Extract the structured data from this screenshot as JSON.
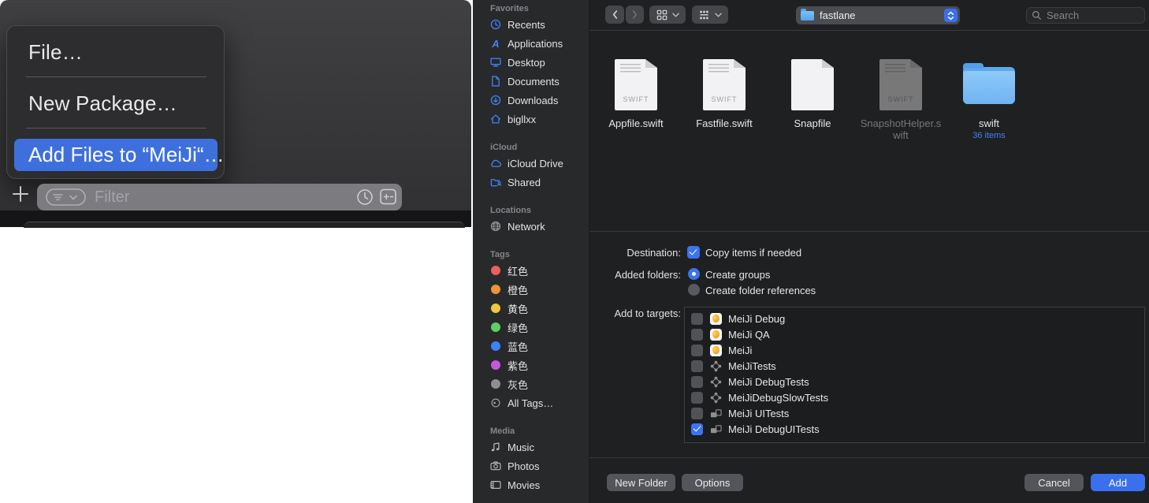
{
  "colors": {
    "accent_blue": "#3a74f2",
    "menu_highlight": "#3e70dd",
    "folder_blue": "#5ea8ef",
    "tag_red": "#ec5f5a",
    "tag_orange": "#eb9439",
    "tag_yellow": "#f0c63f",
    "tag_green": "#5dd064",
    "tag_blue": "#3d82f7",
    "tag_purple": "#c558dc",
    "tag_gray": "#8e8e93"
  },
  "context_menu": {
    "items": [
      {
        "label": "File…"
      },
      {
        "label": "New Package…"
      },
      {
        "label": "Add Files to “MeiJi“…",
        "highlighted": true
      }
    ]
  },
  "bottom_bar": {
    "filter_placeholder": "Filter"
  },
  "sidebar": {
    "sections": [
      {
        "title": "Favorites",
        "items": [
          {
            "label": "Recents"
          },
          {
            "label": "Applications"
          },
          {
            "label": "Desktop"
          },
          {
            "label": "Documents"
          },
          {
            "label": "Downloads"
          },
          {
            "label": "bigllxx"
          }
        ]
      },
      {
        "title": "iCloud",
        "items": [
          {
            "label": "iCloud Drive"
          },
          {
            "label": "Shared"
          }
        ]
      },
      {
        "title": "Locations",
        "items": [
          {
            "label": "Network"
          }
        ]
      },
      {
        "title": "Tags",
        "items": [
          {
            "label": "红色",
            "color": "#ec5f5a"
          },
          {
            "label": "橙色",
            "color": "#eb9439"
          },
          {
            "label": "黄色",
            "color": "#f0c63f"
          },
          {
            "label": "绿色",
            "color": "#5dd064"
          },
          {
            "label": "蓝色",
            "color": "#3d82f7"
          },
          {
            "label": "紫色",
            "color": "#c558dc"
          },
          {
            "label": "灰色",
            "color": "#8e8e93"
          },
          {
            "label": "All Tags…"
          }
        ]
      },
      {
        "title": "Media",
        "items": [
          {
            "label": "Music"
          },
          {
            "label": "Photos"
          },
          {
            "label": "Movies"
          }
        ]
      }
    ]
  },
  "toolbar": {
    "current_folder": "fastlane",
    "search_placeholder": "Search"
  },
  "files": [
    {
      "name": "Appfile.swift",
      "badge": "SWIFT"
    },
    {
      "name": "Fastfile.swift",
      "badge": "SWIFT"
    },
    {
      "name": "Snapfile",
      "badge": ""
    },
    {
      "name": "SnapshotHelper.swift",
      "badge": "SWIFT",
      "dimmed": true
    },
    {
      "name": "swift",
      "type": "folder",
      "item_count": "36 items"
    }
  ],
  "options": {
    "destination_label": "Destination:",
    "copy_items_label": "Copy items if needed",
    "copy_items_checked": true,
    "added_folders_label": "Added folders:",
    "create_groups_label": "Create groups",
    "create_groups_selected": true,
    "create_folder_refs_label": "Create folder references",
    "add_to_targets_label": "Add to targets:"
  },
  "targets": [
    {
      "name": "MeiJi Debug",
      "icon": "app",
      "checked": false
    },
    {
      "name": "MeiJi QA",
      "icon": "app",
      "checked": false
    },
    {
      "name": "MeiJi",
      "icon": "app",
      "checked": false
    },
    {
      "name": "MeiJiTests",
      "icon": "test",
      "checked": false
    },
    {
      "name": "MeiJi DebugTests",
      "icon": "test",
      "checked": false
    },
    {
      "name": "MeiJiDebugSlowTests",
      "icon": "test",
      "checked": false
    },
    {
      "name": "MeiJi UITests",
      "icon": "uitest",
      "checked": false
    },
    {
      "name": "MeiJi DebugUITests",
      "icon": "uitest",
      "checked": true
    }
  ],
  "footer": {
    "new_folder_label": "New Folder",
    "options_label": "Options",
    "cancel_label": "Cancel",
    "add_label": "Add"
  }
}
